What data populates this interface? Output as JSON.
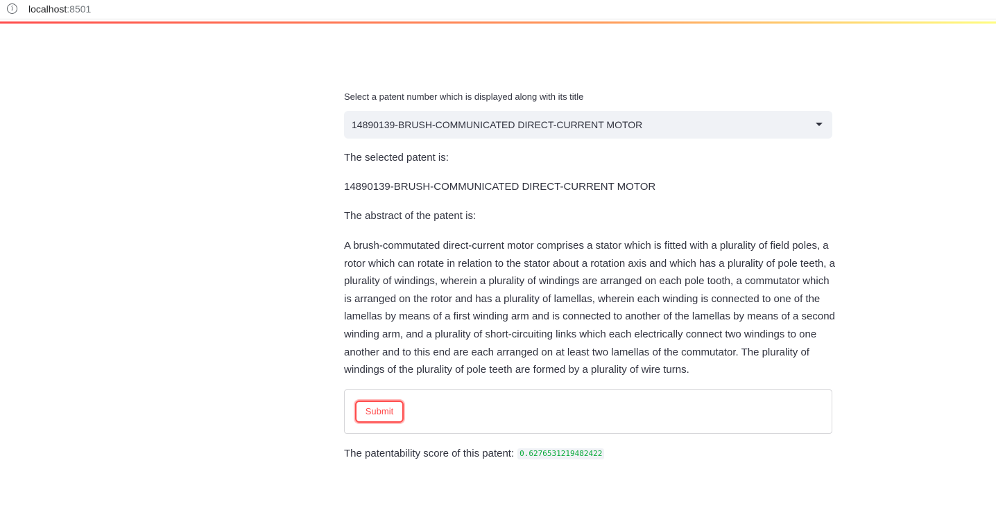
{
  "browser": {
    "host": "localhost",
    "port": ":8501"
  },
  "colors": {
    "accent": "#ff4b4b",
    "select_bg": "#f0f2f6",
    "text": "#31333f",
    "score_green": "#09ab3b"
  },
  "select": {
    "label": "Select a patent number which is displayed along with its title",
    "value": "14890139-BRUSH-COMMUNICATED DIRECT-CURRENT MOTOR",
    "icon": "chevron-down-icon"
  },
  "selected": {
    "heading": "The selected patent is:",
    "value": "14890139-BRUSH-COMMUNICATED DIRECT-CURRENT MOTOR"
  },
  "abstract": {
    "heading": "The abstract of the patent is:",
    "text": "A brush-commutated direct-current motor comprises a stator which is fitted with a plurality of field poles, a rotor which can rotate in relation to the stator about a rotation axis and which has a plurality of pole teeth, a plurality of windings, wherein a plurality of windings are arranged on each pole tooth, a commutator which is arranged on the rotor and has a plurality of lamellas, wherein each winding is connected to one of the lamellas by means of a first winding arm and is connected to another of the lamellas by means of a second winding arm, and a plurality of short-circuiting links which each electrically connect two windings to one another and to this end are each arranged on at least two lamellas of the commutator. The plurality of windings of the plurality of pole teeth are formed by a plurality of wire turns."
  },
  "form": {
    "submit_label": "Submit"
  },
  "result": {
    "label": "The patentability score of this patent:",
    "score": "0.6276531219482422"
  }
}
